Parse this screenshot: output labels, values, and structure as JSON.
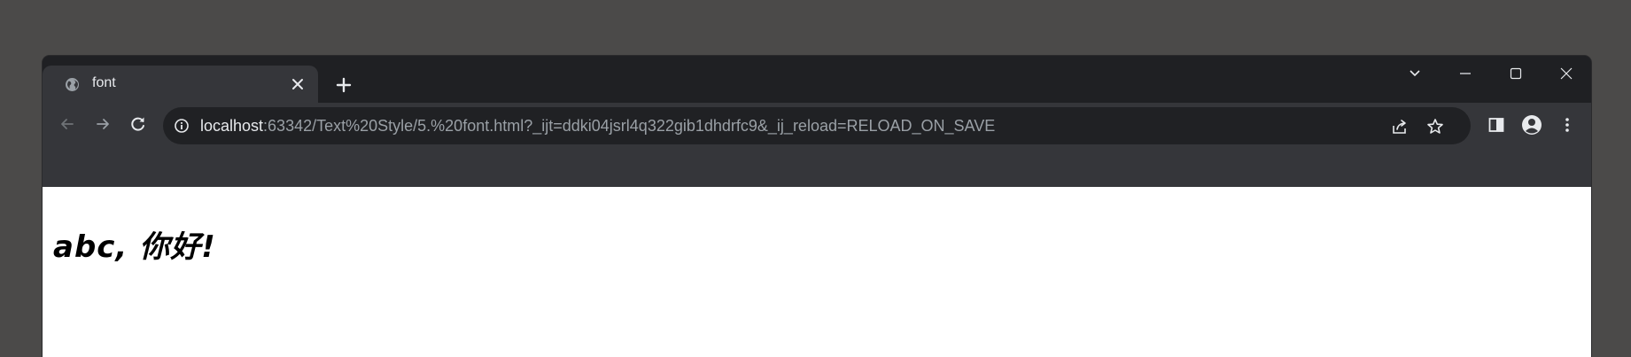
{
  "tab": {
    "title": "font",
    "favicon": "globe-icon",
    "close_glyph": "✕"
  },
  "new_tab": {
    "icon": "plus-icon"
  },
  "window_controls": [
    "chevron-down-icon",
    "minimize-icon",
    "maximize-icon",
    "close-icon"
  ],
  "toolbar": {
    "back": "arrow-left-icon",
    "forward": "arrow-right-icon",
    "reload": "reload-icon"
  },
  "address_bar": {
    "host": "localhost",
    "rest": ":63342/Text%20Style/5.%20font.html?_ijt=ddki04jsrl4q322gib1dhdrfc9&_ij_reload=RELOAD_ON_SAVE",
    "info_icon": "info-icon",
    "share_icon": "share-icon",
    "bookmark_icon": "star-icon"
  },
  "extensions": {
    "side_panel": "side-panel-icon",
    "profile": "profile-icon",
    "menu": "kebab-menu-icon"
  },
  "page": {
    "text": "abc, 你好!"
  },
  "colors": {
    "desktop": "#4b4a49",
    "tabstrip": "#1f2023",
    "toolbar": "#35363a",
    "omnibox": "#202124",
    "page_bg": "#ffffff"
  }
}
